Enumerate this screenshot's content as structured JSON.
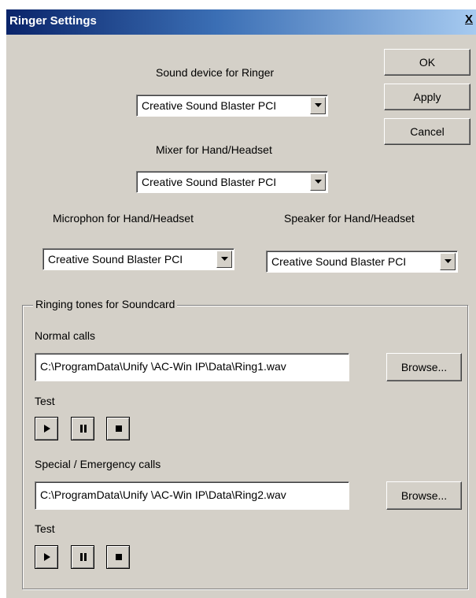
{
  "window": {
    "title": "Ringer Settings",
    "close_glyph": "X"
  },
  "buttons": {
    "ok": "OK",
    "apply": "Apply",
    "cancel": "Cancel"
  },
  "devices": {
    "ringer_label": "Sound device for Ringer",
    "ringer_value": "Creative Sound Blaster PCI",
    "mixer_label": "Mixer for Hand/Headset",
    "mixer_value": "Creative Sound Blaster PCI",
    "mic_label": "Microphon for Hand/Headset",
    "mic_value": "Creative Sound Blaster PCI",
    "speaker_label": "Speaker for Hand/Headset",
    "speaker_value": "Creative Sound Blaster PCI"
  },
  "ringing": {
    "group_title": "Ringing tones for Soundcard",
    "normal_label": "Normal calls",
    "normal_path": "C:\\ProgramData\\Unify \\AC-Win IP\\Data\\Ring1.wav",
    "special_label": "Special / Emergency calls",
    "special_path": "C:\\ProgramData\\Unify \\AC-Win IP\\Data\\Ring2.wav",
    "browse_label": "Browse...",
    "test_label": "Test"
  },
  "icons": {
    "dropdown": "dropdown-arrow-icon",
    "play": "play-icon",
    "pause": "pause-icon",
    "stop": "stop-icon"
  }
}
